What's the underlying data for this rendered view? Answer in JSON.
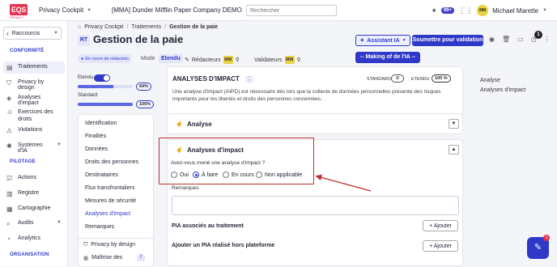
{
  "topbar": {
    "logo": "EQS",
    "logo_sub": "PRIVACY",
    "app_name": "Privacy Cockpit",
    "company": "[MMA] Dunder Mifflin Paper Company DEMO",
    "search_placeholder": "Rechercher",
    "notif_count": "99+",
    "user_initials": "MM",
    "user_name": "Michael Marette"
  },
  "sidebar": {
    "shortcut_label": "Raccourcis",
    "sections": [
      {
        "title": "CONFORMITÉ",
        "items": [
          {
            "label": "Traitements",
            "active": true
          },
          {
            "label": "Privacy by design"
          },
          {
            "label": "Analyses d'impact"
          },
          {
            "label": "Exercices des droits"
          },
          {
            "label": "Violations"
          },
          {
            "label": "Systèmes d'IA"
          }
        ]
      },
      {
        "title": "PILOTAGE",
        "items": [
          {
            "label": "Actions"
          },
          {
            "label": "Registre"
          },
          {
            "label": "Cartographie"
          },
          {
            "label": "Audits"
          },
          {
            "label": "Analytics"
          }
        ]
      },
      {
        "title": "ORGANISATION",
        "items": []
      }
    ]
  },
  "breadcrumb": [
    "Privacy Cockpit",
    "Traitements",
    "Gestion de la paie"
  ],
  "header": {
    "badge": "RT",
    "title": "Gestion de la paie",
    "ai_assistant": "Assistant IA",
    "submit": "Soumettre pour validation",
    "count": "1"
  },
  "meta": {
    "status": "En cours de rédaction",
    "mode_label": "Mode",
    "mode_value": "Etendu",
    "editors_label": "Rédacteurs",
    "validators_label": "Validateurs",
    "initials": "MM",
    "making_of": "-- Making of de l'IA --"
  },
  "progress": {
    "etendu_label": "Etendu",
    "etendu_pct": "64%",
    "etendu_value": 0.64,
    "standard_label": "Standard",
    "standard_pct": "100%",
    "standard_value": 1.0
  },
  "nav": {
    "items": [
      "Identification",
      "Finalités",
      "Données",
      "Droits des personnes",
      "Destinataires",
      "Flux transfrontaliers",
      "Mesures de sécurité",
      "Analyses d'impact",
      "Remarques"
    ],
    "active_index": 7,
    "subcards": [
      "Privacy by design",
      "Maîtrise des"
    ],
    "sub_count": "7"
  },
  "impact_card": {
    "title": "ANALYSES D'IMPACT",
    "description": "Une analyse d'impact (AIPD) est nécessaire dès lors que la collecte de données personnelles présente des risques importants pour les libertés et droits des personnes concernées.",
    "standard_label": "STANDARD",
    "etendu_label": "ETENDU",
    "etendu_pct": "100 %"
  },
  "analyse_section": {
    "title": "Analyse"
  },
  "analyses_section": {
    "title": "Analyses d'impact",
    "question": "Avez-vous mené une analyse d'impact ?",
    "options": [
      "Oui",
      "À faire",
      "En cours",
      "Non applicable"
    ],
    "selected": "À faire",
    "remarks_label": "Remarques",
    "pia_label": "PIA associés au traitement",
    "pia_add": "Ajouter",
    "external_label": "Ajouter un PIA réalisé hors plateforme",
    "external_add": "Ajouter"
  },
  "toc": [
    "Analyse",
    "Analyses d'impact"
  ],
  "chat": {
    "badge": "1"
  }
}
